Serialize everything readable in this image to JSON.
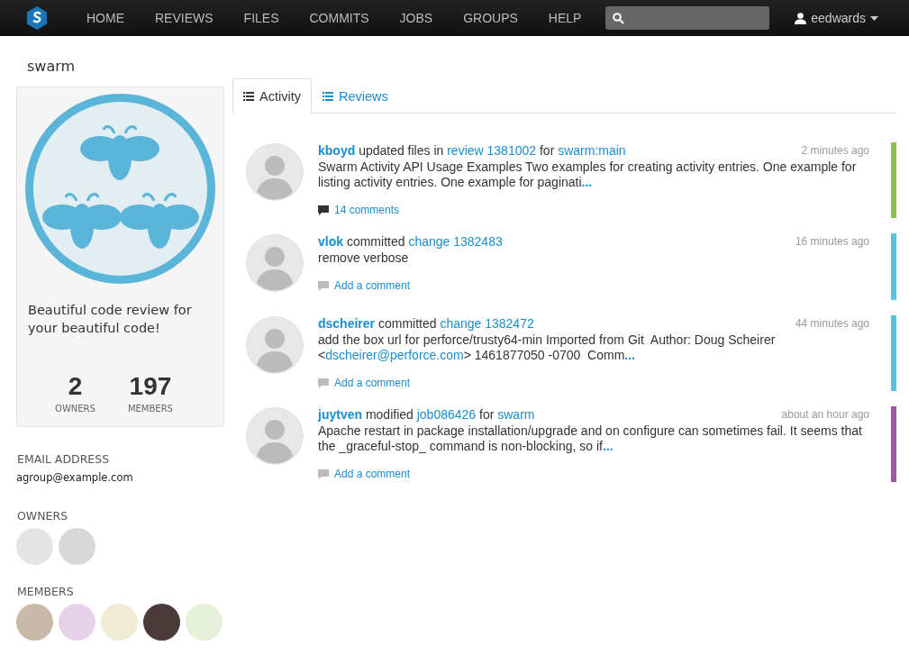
{
  "navbar": {
    "items": [
      {
        "label": "HOME",
        "selected": false
      },
      {
        "label": "REVIEWS",
        "selected": false
      },
      {
        "label": "FILES",
        "selected": false
      },
      {
        "label": "COMMITS",
        "selected": false
      },
      {
        "label": "JOBS",
        "selected": false
      },
      {
        "label": "GROUPS",
        "selected": false
      },
      {
        "label": "HELP",
        "selected": false
      }
    ],
    "user": "eedwards"
  },
  "group": {
    "name": "swarm",
    "description": "Beautiful code review for your beautiful code!",
    "stats": [
      {
        "value": "2",
        "label": "OWNERS"
      },
      {
        "value": "197",
        "label": "MEMBERS"
      }
    ],
    "email_label": "EMAIL ADDRESS",
    "email": "agroup@example.com",
    "owners_label": "OWNERS",
    "owners": [
      {
        "color": "#e4e4e4"
      },
      {
        "color": "#d8d8d8"
      }
    ],
    "members_label": "MEMBERS",
    "members": [
      {
        "color": "#c9b9a8"
      },
      {
        "color": "#e6d3ea"
      },
      {
        "color": "#f0ecd4"
      },
      {
        "color": "#4a3a3a"
      },
      {
        "color": "#e6efd8"
      }
    ]
  },
  "tabs": [
    {
      "label": "Activity",
      "selected": true
    },
    {
      "label": "Reviews",
      "selected": false
    }
  ],
  "activity": [
    {
      "user": "kboyd",
      "header": [
        {
          "kind": "text",
          "text": "updated files in"
        },
        {
          "kind": "link",
          "text": "review 1381002"
        },
        {
          "kind": "text",
          "text": "for"
        },
        {
          "kind": "link",
          "text": "swarm:main"
        }
      ],
      "time": "2 minutes ago",
      "body": [
        {
          "kind": "text",
          "text": "Swarm Activity API Usage Examples Two examples for creating activity entries. One example for listing activity entries. One example for paginati"
        },
        {
          "kind": "more",
          "text": "..."
        }
      ],
      "comment": {
        "text": "14 comments",
        "has_comments": true
      },
      "color": "#8cc152"
    },
    {
      "user": "vlok",
      "header": [
        {
          "kind": "text",
          "text": "committed"
        },
        {
          "kind": "link",
          "text": "change 1382483"
        }
      ],
      "time": "16 minutes ago",
      "body": [
        {
          "kind": "text",
          "text": "remove verbose"
        }
      ],
      "comment": {
        "text": "Add a comment",
        "has_comments": false
      },
      "color": "#5bc0de"
    },
    {
      "user": "dscheirer",
      "header": [
        {
          "kind": "text",
          "text": "committed"
        },
        {
          "kind": "link",
          "text": "change 1382472"
        }
      ],
      "time": "44 minutes ago",
      "body": [
        {
          "kind": "text",
          "text": "add the box url for perforce/trusty64-min Imported from Git  Author: Doug Scheirer <"
        },
        {
          "kind": "link",
          "text": "dscheirer@perforce.com"
        },
        {
          "kind": "text",
          "text": "> 1461877050 -0700  Comm"
        },
        {
          "kind": "more",
          "text": "..."
        }
      ],
      "comment": {
        "text": "Add a comment",
        "has_comments": false
      },
      "color": "#5bc0de"
    },
    {
      "user": "juytven",
      "header": [
        {
          "kind": "text",
          "text": "modified"
        },
        {
          "kind": "link",
          "text": "job086426"
        },
        {
          "kind": "text",
          "text": "for"
        },
        {
          "kind": "link",
          "text": "swarm"
        }
      ],
      "time": "about an hour ago",
      "body": [
        {
          "kind": "text",
          "text": "Apache restart in package installation/upgrade and on configure can sometimes fail. It seems that the _graceful-stop_ command is non-blocking, so if"
        },
        {
          "kind": "more",
          "text": "..."
        }
      ],
      "comment": {
        "text": "Add a comment",
        "has_comments": false
      },
      "color": "#9b59a0"
    }
  ]
}
